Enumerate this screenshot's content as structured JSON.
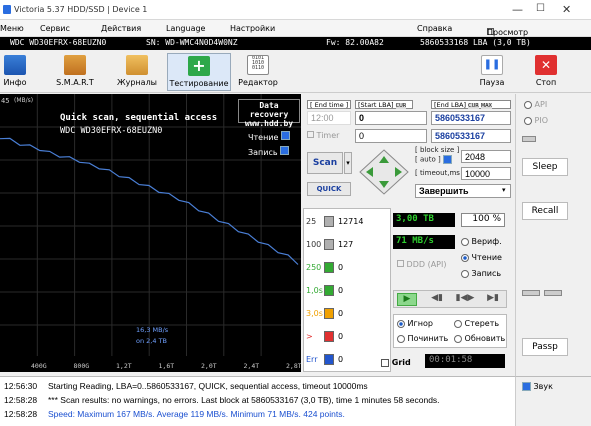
{
  "window": {
    "title": "Victoria 5.37 HDD/SSD | Device 1"
  },
  "menu": {
    "items": [
      "Меню",
      "Сервис",
      "Действия",
      "Language",
      "Настройки",
      "Справка"
    ],
    "view_buffer": "Просмотр буфера"
  },
  "drive": {
    "model": "WDC WD30EFRX-68EUZN0",
    "serial": "SN: WD-WMC4N0D4W0NZ",
    "firmware": "Fw: 82.00A82",
    "capacity": "5860533168 LBA (3,0 TB)"
  },
  "toolbar": {
    "info": "Инфо",
    "smart": "S.M.A.R.T",
    "journals": "Журналы",
    "testing": "Тестирование",
    "editor": "Редактор",
    "pause": "Пауза",
    "stop": "Стоп"
  },
  "graph": {
    "header": "Quick scan, sequential access",
    "model": "WDC WD30EFRX-68EUZN0",
    "watermark_line1": "Data recovery",
    "watermark_line2": "www.hdd.by",
    "reading_label": "Чтение",
    "writing_label": "Запись",
    "speed_readout": "16,3 MB/s",
    "position_readout": "on 2,4 TB",
    "y_unit": "MB/s",
    "y_ticks": [
      "45"
    ],
    "x_ticks": [
      "400G",
      "800G",
      "1,2T",
      "1,6T",
      "2,0T",
      "2,4T",
      "2,8T"
    ]
  },
  "chart_data": {
    "type": "line",
    "title": "Quick scan, sequential access",
    "xlabel": "",
    "ylabel": "MB/s",
    "x": [
      0,
      0.1,
      0.2,
      0.3,
      0.4,
      0.5,
      0.6,
      0.7,
      0.8,
      0.9,
      1.0,
      1.1,
      1.2,
      1.3,
      1.4,
      1.5,
      1.6,
      1.7,
      1.8,
      1.9,
      2.0,
      2.1,
      2.2,
      2.3,
      2.4,
      2.5,
      2.6,
      2.7,
      2.8,
      2.9,
      3.0
    ],
    "series": [
      {
        "values": [
          167,
          165,
          162,
          160,
          158,
          155,
          153,
          151,
          149,
          146,
          144,
          141,
          138,
          135,
          132,
          129,
          126,
          123,
          120,
          116,
          112,
          108,
          104,
          100,
          96,
          92,
          88,
          84,
          80,
          76,
          71
        ]
      }
    ],
    "xlim": [
      0,
      3.0
    ],
    "ylim": [
      0,
      200
    ],
    "grid": true
  },
  "controls": {
    "end_time_label": "End time",
    "end_time_value": "12:00",
    "start_lba_label": "Start LBA",
    "start_lba_value": "0",
    "end_lba_label": "End LBA",
    "end_lba_value": "5860533167",
    "cur_label": "CUR",
    "max_label": "MAX",
    "timer_label": "Timer",
    "timer_value": "0",
    "end_lba_value2": "5860533167",
    "scan_button": "Scan",
    "quick_button": "QUICK",
    "block_size_label": "block size",
    "auto_label": "auto",
    "block_size_value": "2048",
    "timeout_label": "timeout,ms",
    "timeout_value": "10000",
    "finish_label": "Завершить"
  },
  "histogram": [
    {
      "label": "25",
      "count": "12714",
      "color": "#b0b0b0"
    },
    {
      "label": "100",
      "count": "127",
      "color": "#b0b0b0"
    },
    {
      "label": "250",
      "count": "0",
      "color": "#33aa33"
    },
    {
      "label": "1,0s",
      "count": "0",
      "color": "#33aa33"
    },
    {
      "label": "3,0s",
      "count": "0",
      "color": "#f0a000"
    },
    {
      "label": ">",
      "count": "0",
      "color": "#e03030"
    },
    {
      "label": "Err",
      "count": "0",
      "color": "#2255cc"
    }
  ],
  "stats": {
    "size": "3,00 TB",
    "percent": "100",
    "percent_unit": "%",
    "speed": "71 MB/s",
    "verify": "Вериф.",
    "read": "Чтение",
    "write": "Запись",
    "ddd": "DDD (API)",
    "ignore": "Игнор",
    "erase": "Стереть",
    "fix": "Починить",
    "update": "Обновить",
    "grid": "Grid",
    "timer_display": "00:01:58"
  },
  "side": {
    "api": "API",
    "pio": "PIO",
    "sleep": "Sleep",
    "recall": "Recall",
    "passp": "Passp",
    "sound": "Звук"
  },
  "log": [
    {
      "time": "12:56:30",
      "text": "Starting Reading, LBA=0..5860533167, QUICK, sequential access, timeout 10000ms",
      "color": "#000000"
    },
    {
      "time": "12:58:28",
      "text": "*** Scan results: no warnings, no errors. Last block at 5860533167 (3,0 TB), time 1 minutes 58 seconds.",
      "color": "#000000"
    },
    {
      "time": "12:58:28",
      "text": "Speed: Maximum 167 MB/s. Average 119 MB/s. Minimum 71 MB/s. 424 points.",
      "color": "#1a4fd0"
    }
  ],
  "colors": {
    "accent": "#2a6de0",
    "graph_bg": "#000000",
    "curve": "#4a7fd6",
    "green_text": "#2fd02f"
  }
}
